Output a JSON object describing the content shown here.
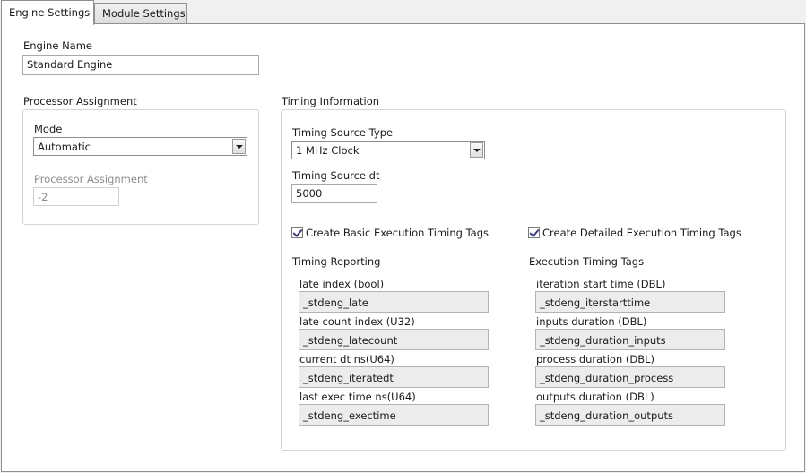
{
  "tabs": [
    {
      "label": "Engine Settings"
    },
    {
      "label": "Module Settings"
    }
  ],
  "engine_name": {
    "label": "Engine Name",
    "value": "Standard Engine"
  },
  "processor": {
    "group_label": "Processor Assignment",
    "mode_label": "Mode",
    "mode_value": "Automatic",
    "assignment_label": "Processor Assignment",
    "assignment_value": "-2"
  },
  "timing": {
    "group_label": "Timing Information",
    "source_type_label": "Timing Source Type",
    "source_type_value": "1 MHz Clock",
    "source_dt_label": "Timing Source dt",
    "source_dt_value": "5000",
    "basic_checkbox_label": "Create Basic Execution Timing Tags",
    "basic_checked": true,
    "detailed_checkbox_label": "Create Detailed Execution Timing Tags",
    "detailed_checked": true,
    "reporting": {
      "header": "Timing Reporting",
      "rows": [
        {
          "label": "late index (bool)",
          "value": "_stdeng_late"
        },
        {
          "label": "late count index (U32)",
          "value": "_stdeng_latecount"
        },
        {
          "label": "current dt ns(U64)",
          "value": "_stdeng_iteratedt"
        },
        {
          "label": "last exec time ns(U64)",
          "value": "_stdeng_exectime"
        }
      ]
    },
    "execution": {
      "header": "Execution Timing Tags",
      "rows": [
        {
          "label": "iteration start time (DBL)",
          "value": "_stdeng_iterstarttime"
        },
        {
          "label": "inputs duration (DBL)",
          "value": "_stdeng_duration_inputs"
        },
        {
          "label": "process duration (DBL)",
          "value": "_stdeng_duration_process"
        },
        {
          "label": "outputs duration (DBL)",
          "value": "_stdeng_duration_outputs"
        }
      ]
    }
  }
}
